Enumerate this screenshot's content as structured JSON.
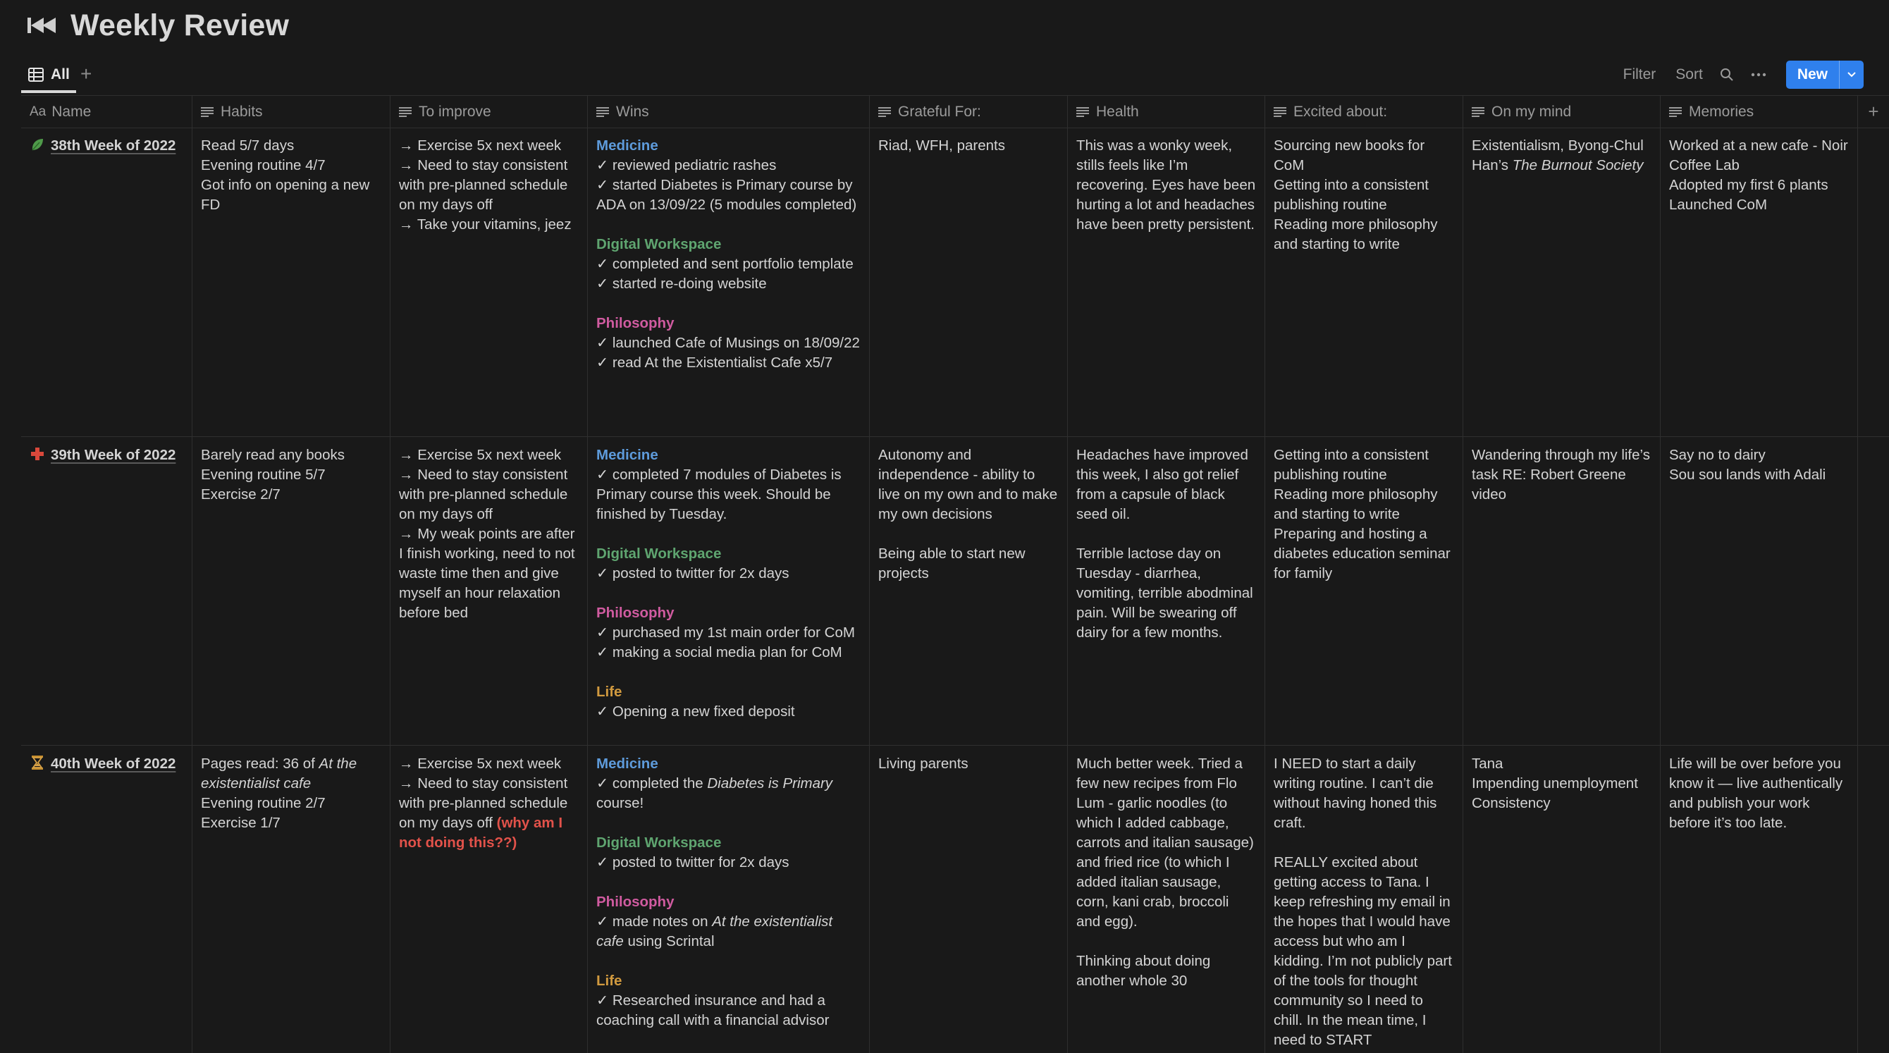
{
  "page": {
    "title": "Weekly Review"
  },
  "view": {
    "tab_label": "All",
    "add_view": "+"
  },
  "toolbar": {
    "filter_label": "Filter",
    "sort_label": "Sort",
    "new_label": "New"
  },
  "columns": {
    "name": {
      "prefix": "Aa",
      "label": "Name"
    },
    "habits": "Habits",
    "improve": "To improve",
    "wins": "Wins",
    "grateful": "Grateful For:",
    "health": "Health",
    "excited": "Excited about:",
    "mind": "On my mind",
    "memories": "Memories",
    "add": "+"
  },
  "icons": {
    "title": "rewind-icon",
    "row1": "leaf-icon",
    "row2": "red-cross-icon",
    "row3": "hourglass-icon"
  },
  "colors": {
    "medicine": "#5e9bdb",
    "digital_workspace": "#5fa570",
    "philosophy": "#d05ba0",
    "life": "#d19a3f",
    "highlight_red": "#e2524a",
    "new_button": "#2f80ed"
  },
  "rows": [
    {
      "name": "38th Week of 2022",
      "habits": [
        "Read 5/7 days",
        "Evening routine 4/7",
        "Got info on opening a new FD"
      ],
      "improve": [
        "→ Exercise 5x next week",
        "→ Need to stay consistent with pre-planned schedule on my days off",
        "→ Take your vitamins, jeez"
      ],
      "wins": {
        "medicine": "Medicine",
        "medicine_items": [
          "✓ reviewed pediatric rashes",
          "✓ started Diabetes is Primary course by ADA on 13/09/22 (5 modules completed)"
        ],
        "digital": "Digital Workspace",
        "digital_items": [
          "✓ completed and sent portfolio template",
          "✓ started re-doing website"
        ],
        "philosophy": "Philosophy",
        "philosophy_items": [
          "✓ launched Cafe of Musings on 18/09/22",
          "✓ read At the Existentialist Cafe x5/7"
        ]
      },
      "grateful": [
        "Riad, WFH, parents"
      ],
      "health": [
        "This was a wonky week, stills feels like I’m recovering. Eyes have been hurting a lot and headaches have been pretty persistent."
      ],
      "excited": [
        "Sourcing new books for CoM",
        "Getting into a consistent publishing routine",
        "Reading more philosophy and starting to write"
      ],
      "mind": {
        "text": "Existentialism, Byong-Chul Han’s ",
        "italic": "The Burnout Society"
      },
      "memories": [
        "Worked at a new cafe - Noir Coffee Lab",
        "Adopted my first 6 plants",
        "Launched CoM"
      ]
    },
    {
      "name": "39th Week of 2022",
      "habits": [
        "Barely read any books",
        "Evening routine 5/7",
        "Exercise 2/7"
      ],
      "improve": [
        "→ Exercise 5x next week",
        "→ Need to stay consistent with pre-planned schedule on my days off",
        "→ My weak points are after I finish working, need to not waste time then and give myself an hour relaxation before bed"
      ],
      "wins": {
        "medicine": "Medicine",
        "medicine_items": [
          "✓ completed 7 modules of Diabetes is Primary course this week. Should be finished by Tuesday."
        ],
        "digital": "Digital Workspace",
        "digital_items": [
          "✓ posted to twitter for 2x days"
        ],
        "philosophy": "Philosophy",
        "philosophy_items": [
          "✓ purchased my 1st main order for CoM",
          "✓ making a social media plan for CoM"
        ],
        "life": "Life",
        "life_items": [
          "✓ Opening a new fixed deposit"
        ]
      },
      "grateful": [
        "Autonomy and independence - ability to live on my own and to make my own decisions",
        "Being able to start new projects"
      ],
      "health": [
        "Headaches have improved this week, I also got relief from a capsule of black seed oil.",
        "Terrible lactose day on Tuesday - diarrhea, vomiting, terrible abodminal pain. Will be swearing off dairy for a few months."
      ],
      "excited": [
        "Getting into a consistent publishing routine",
        "Reading more philosophy and starting to write",
        "Preparing and hosting a diabetes education seminar for family"
      ],
      "mind": {
        "text": "Wandering through my life’s task RE: Robert Greene video"
      },
      "memories": [
        "Say no to dairy",
        "Sou sou lands with Adali"
      ]
    },
    {
      "name": "40th Week of 2022",
      "habits": {
        "pages_prefix": "Pages read: 36 of ",
        "pages_book": "At the existentialist cafe",
        "evening": "Evening routine 2/7",
        "exercise": "Exercise 1/7"
      },
      "improve": {
        "a": "→ Exercise 5x next week",
        "b": "→ Need to stay consistent with pre-planned schedule on my days off ",
        "b_red": "(why am I not doing this??)"
      },
      "wins": {
        "medicine": "Medicine",
        "medicine_pre": "✓ completed the ",
        "medicine_it": "Diabetes is Primary",
        "medicine_post": " course!",
        "digital": "Digital Workspace",
        "digital_items": [
          "✓ posted to twitter for 2x days"
        ],
        "philosophy": "Philosophy",
        "philosophy_pre": "✓ made notes on ",
        "philosophy_it": "At the existentialist cafe",
        "philosophy_post": " using Scrintal",
        "life": "Life",
        "life_items": [
          "✓ Researched insurance and had a coaching call with a financial advisor"
        ]
      },
      "grateful": [
        "Living parents"
      ],
      "health": [
        "Much better week. Tried a few new recipes from Flo Lum - garlic noodles (to which I added cabbage, carrots and italian sausage) and fried rice (to which I added italian sausage, corn, kani crab, broccoli and egg).",
        "Thinking about doing another whole 30"
      ],
      "excited": [
        "I NEED to start a daily writing routine. I can’t die without having honed this craft.",
        "REALLY excited about getting access to Tana. I keep refreshing my email in the hopes that I would have access but who am I kidding. I’m not publicly part of the tools for thought community so I need to chill. In the mean time, I need to START"
      ],
      "mind": [
        "Tana",
        "Impending unemployment",
        "Consistency"
      ],
      "memories": [
        "Life will be over before you know it — live authentically and publish your work before it’s too late."
      ]
    }
  ]
}
